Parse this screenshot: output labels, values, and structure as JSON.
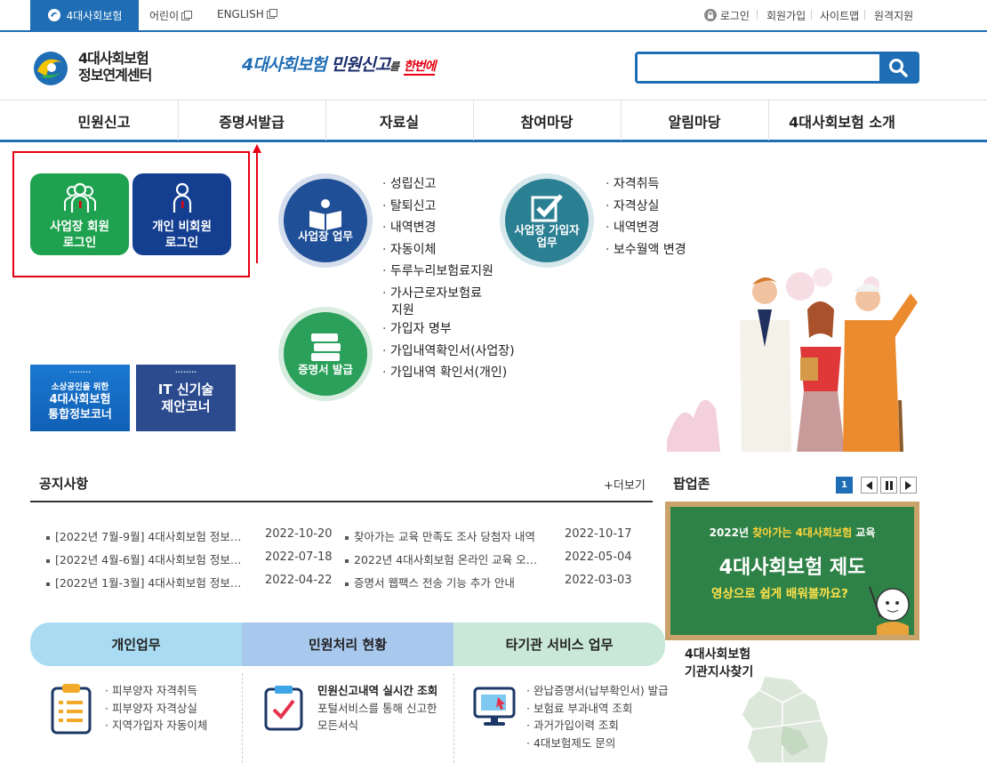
{
  "topbar": {
    "main_tab": "4대사회보험",
    "kids": "어린이",
    "english": "ENGLISH",
    "login": "로그인",
    "join": "회원가입",
    "sitemap": "사이트맵",
    "remote": "원격지원"
  },
  "header": {
    "logo_line1": "4대사회보험",
    "logo_line2": "정보연계센터",
    "slogan_a": "4대사회보험",
    "slogan_b": "민원신고",
    "slogan_c": "를",
    "slogan_d": "한번에",
    "search_placeholder": ""
  },
  "gnb": [
    "민원신고",
    "증명서발급",
    "자료실",
    "참여마당",
    "알림마당",
    "4대사회보험 소개"
  ],
  "login": {
    "company_line1": "사업장 회원",
    "company_line2": "로그인",
    "personal_line1": "개인 비회원",
    "personal_line2": "로그인"
  },
  "quick": {
    "biz_label": "사업장 업무",
    "biz_items": [
      "성립신고",
      "탈퇴신고",
      "내역변경",
      "자동이체",
      "두루누리보험료지원",
      "가사근로자보험료",
      "지원"
    ],
    "sub_label_1": "사업장 가입자",
    "sub_label_2": "업무",
    "sub_items": [
      "자격취득",
      "자격상실",
      "내역변경",
      "보수월액 변경"
    ],
    "cert_label": "증명서 발급",
    "cert_items": [
      "가입자 명부",
      "가입내역확인서(사업장)",
      "가입내역 확인서(개인)"
    ]
  },
  "banners": {
    "small_dots": "........",
    "small_line1": "소상공인을 위한",
    "small_line2": "4대사회보험",
    "small_line3": "통합정보코너",
    "it_line1": "IT 신기술",
    "it_line2": "제안코너"
  },
  "notice": {
    "title": "공지사항",
    "more": "+더보기",
    "left": [
      {
        "text": "[2022년 7월-9월] 4대사회보험 정보…",
        "date": "2022-10-20"
      },
      {
        "text": "[2022년 4월-6월] 4대사회보험 정보…",
        "date": "2022-07-18"
      },
      {
        "text": "[2022년 1월-3월] 4대사회보험 정보…",
        "date": "2022-04-22"
      }
    ],
    "right": [
      {
        "text": "찾아가는 교육 만족도 조사 당첨자 내역",
        "date": "2022-10-17"
      },
      {
        "text": "2022년 4대사회보험 온라인 교육 오…",
        "date": "2022-05-04"
      },
      {
        "text": "증명서 웹팩스 전송 기능 추가 안내",
        "date": "2022-03-03"
      }
    ]
  },
  "popup": {
    "title": "팝업존",
    "page": "1",
    "board_line1_a": "2022년 ",
    "board_line1_b": "찾아가는 4대사회보험",
    "board_line1_c": " 교육",
    "board_line2": "4대사회보험 제도",
    "board_line3": "영상으로 쉽게 배워볼까요?"
  },
  "map": {
    "line1": "4대사회보험",
    "line2": "기관지사찾기"
  },
  "services": {
    "tabs": [
      "개인업무",
      "민원처리 현황",
      "타기관 서비스 업무"
    ],
    "personal": [
      "피부양자 자격취득",
      "피부양자 자격상실",
      "지역가입자 자동이체"
    ],
    "status_title": "민원신고내역 실시간 조회",
    "status_desc1": "포털서비스를 통해 신고한",
    "status_desc2": "모든서식",
    "other": [
      "완납증명서(납부확인서) 발급",
      "보험료 부과내역 조회",
      "과거가입이력 조회",
      "4대보험제도 문의"
    ]
  },
  "colors": {
    "primary": "#1f6eb5",
    "green_btn": "#1fa250",
    "navy_btn": "#143f91",
    "highlight": "#e60012"
  }
}
